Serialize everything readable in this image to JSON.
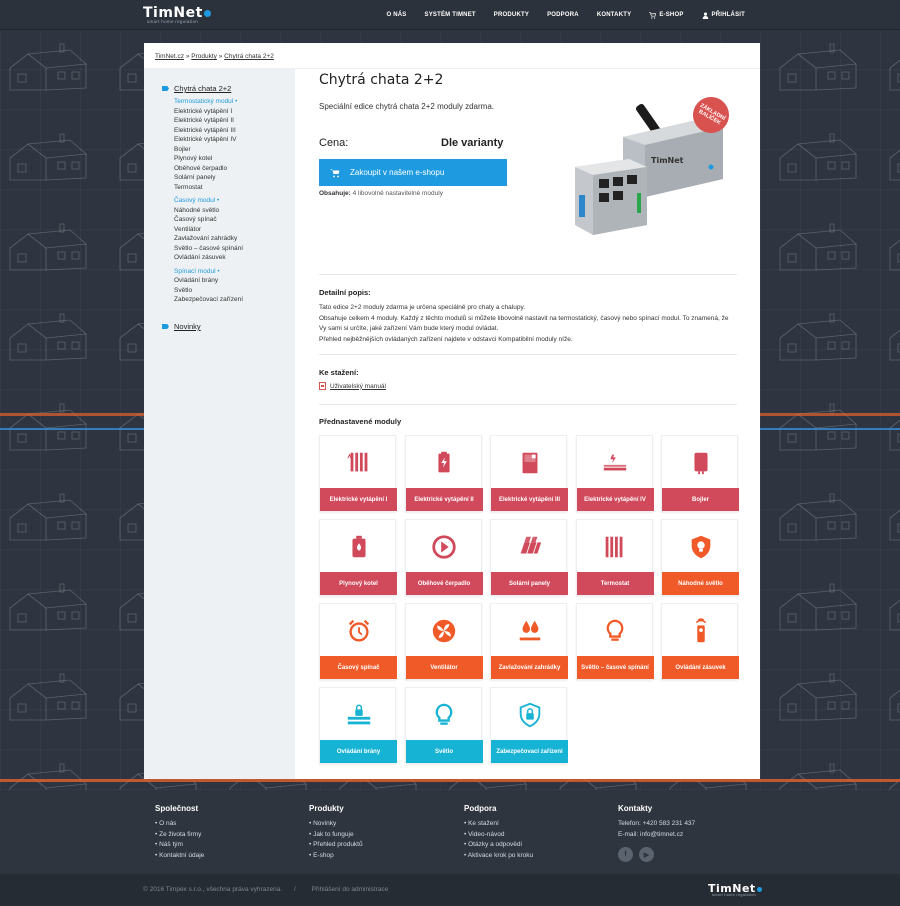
{
  "header": {
    "logo": "TimNet",
    "logo_sub": "smart home regulation",
    "nav": [
      {
        "label": "O NÁS"
      },
      {
        "label": "SYSTÉM TIMNET"
      },
      {
        "label": "PRODUKTY"
      },
      {
        "label": "PODPORA"
      },
      {
        "label": "KONTAKTY"
      },
      {
        "label": "E-SHOP",
        "icon": "cart-icon"
      },
      {
        "label": "PŘIHLÁSIT",
        "icon": "user-icon"
      }
    ]
  },
  "breadcrumb": {
    "home": "TimNet.cz",
    "sep": "»",
    "products": "Produkty",
    "current": "Chytrá chata 2+2"
  },
  "sidebar": {
    "current": "Chytrá chata 2+2",
    "groups": [
      {
        "title": "Termostatický modul",
        "items": [
          "Elektrické vytápění I",
          "Elektrické vytápění II",
          "Elektrické vytápění III",
          "Elektrické vytápění IV",
          "Bojler",
          "Plynový kotel",
          "Oběhové čerpadlo",
          "Solární panely",
          "Termostat"
        ]
      },
      {
        "title": "Časový modul",
        "items": [
          "Náhodné světlo",
          "Časový spínač",
          "Ventilátor",
          "Zavlažování zahrádky",
          "Světlo – časové spínání",
          "Ovládání zásuvek"
        ]
      },
      {
        "title": "Spínací modul",
        "items": [
          "Ovládání brány",
          "Světlo",
          "Zabezpečovací zařízení"
        ]
      }
    ],
    "news": "Novinky"
  },
  "product": {
    "title": "Chytrá chata 2+2",
    "lead": "Speciální edice chytrá chata 2+2 moduly zdarma.",
    "price_label": "Cena:",
    "price_value": "Dle varianty",
    "buy_label": "Zakoupit v našem e-shopu",
    "contains_label": "Obsahuje:",
    "contains_value": "4 libovolně nastavitelné moduly",
    "badge": "ZÁKLADNÍ BALÍČEK",
    "device_brand": "TimNet"
  },
  "detail": {
    "title": "Detailní popis:",
    "lines": [
      "Tato edice 2+2 moduly zdarma je určena speciálně pro chaty a chalupy.",
      "Obsahuje celkem 4 moduly. Každý z těchto modulů si můžete libovolně nastavit na termostatický, časový nebo spínací modul. To znamená, že Vy sami si určíte, jaké zařízení Vám bude který modul ovládat.",
      "Přehled nejběžnějších ovládaných zařízení najdete v odstavci Kompatibilní moduly níže."
    ]
  },
  "downloads": {
    "title": "Ke stažení:",
    "manual": "Uživatelský manuál"
  },
  "modules": {
    "title": "Přednastavené moduly",
    "colors": {
      "red": "#d04a5b",
      "orange": "#f05a28",
      "cyan": "#17b3d4"
    },
    "items": [
      {
        "label": "Elektrické vytápění I",
        "color": "red",
        "icon": "heater-bars-icon"
      },
      {
        "label": "Elektrické vytápění II",
        "color": "red",
        "icon": "battery-bolt-icon"
      },
      {
        "label": "Elektrické vytápění III",
        "color": "red",
        "icon": "tank-icon"
      },
      {
        "label": "Elektrické vytápění IV",
        "color": "red",
        "icon": "floor-heating-icon"
      },
      {
        "label": "Bojler",
        "color": "red",
        "icon": "boiler-icon"
      },
      {
        "label": "Plynový kotel",
        "color": "red",
        "icon": "gas-boiler-icon"
      },
      {
        "label": "Oběhové čerpadlo",
        "color": "red",
        "icon": "pump-icon"
      },
      {
        "label": "Solární panely",
        "color": "red",
        "icon": "solar-panel-icon"
      },
      {
        "label": "Termostat",
        "color": "red",
        "icon": "radiator-icon"
      },
      {
        "label": "Náhodné světlo",
        "color": "orange",
        "icon": "shield-bulb-icon"
      },
      {
        "label": "Časový spínač",
        "color": "orange",
        "icon": "alarm-clock-icon"
      },
      {
        "label": "Ventilátor",
        "color": "orange",
        "icon": "fan-icon"
      },
      {
        "label": "Zavlažování zahrádky",
        "color": "orange",
        "icon": "water-drops-icon"
      },
      {
        "label": "Světlo – časové spínání",
        "color": "orange",
        "icon": "bulb-icon"
      },
      {
        "label": "Ovládání zásuvek",
        "color": "orange",
        "icon": "remote-icon"
      },
      {
        "label": "Ovládání brány",
        "color": "cyan",
        "icon": "gate-lock-icon"
      },
      {
        "label": "Světlo",
        "color": "cyan",
        "icon": "bulb-icon"
      },
      {
        "label": "Zabezpečovací zařízení",
        "color": "cyan",
        "icon": "shield-lock-icon"
      }
    ]
  },
  "footer": {
    "cols": [
      {
        "title": "Společnost",
        "items": [
          "O nás",
          "Ze života firmy",
          "Náš tým",
          "Kontaktní údaje"
        ]
      },
      {
        "title": "Produkty",
        "items": [
          "Novinky",
          "Jak to funguje",
          "Přehled produktů",
          "E-shop"
        ]
      },
      {
        "title": "Podpora",
        "items": [
          "Ke stažení",
          "Video-návod",
          "Otázky a odpovědi",
          "Aktivace krok po kroku"
        ]
      }
    ],
    "contact": {
      "title": "Kontakty",
      "phone": "Telefon: +420 583 231 437",
      "email": "E-mail: info@timnet.cz"
    },
    "copyright": "© 2016 Timpex s.r.o., všechna práva vyhrazena.",
    "sep": "/",
    "admin": "Přihlášení do administrace"
  }
}
